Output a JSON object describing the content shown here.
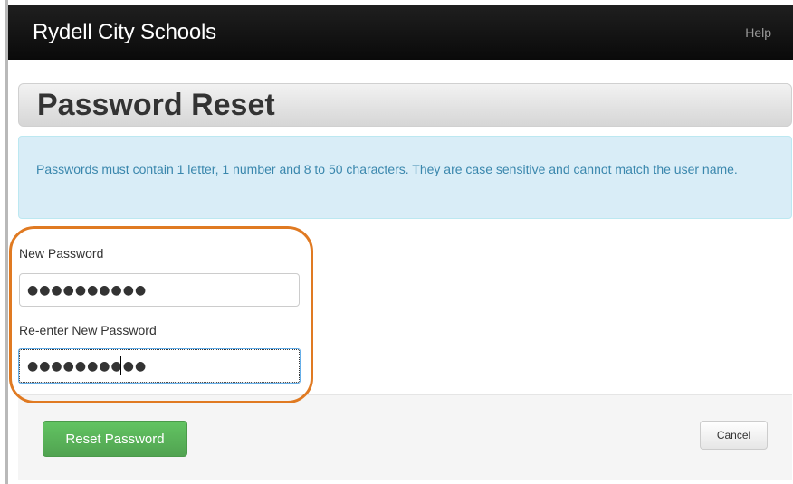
{
  "navbar": {
    "brand": "Rydell City Schools",
    "help_label": "Help"
  },
  "page": {
    "title": "Password Reset"
  },
  "info": {
    "text": "Passwords must contain 1 letter, 1 number and 8 to 50 characters. They are case sensitive and cannot match the user name."
  },
  "form": {
    "new_password_label": "New Password",
    "new_password_value": "●●●●●●●●●●",
    "reenter_password_label": "Re-enter New Password",
    "reenter_password_value": "●●●●●●●●●●"
  },
  "actions": {
    "reset_label": "Reset Password",
    "cancel_label": "Cancel"
  },
  "colors": {
    "navbar": "#121212",
    "info_background": "#d9edf7",
    "info_text": "#3a87ad",
    "primary_button": "#5bb75b",
    "highlight": "#e07a22"
  }
}
